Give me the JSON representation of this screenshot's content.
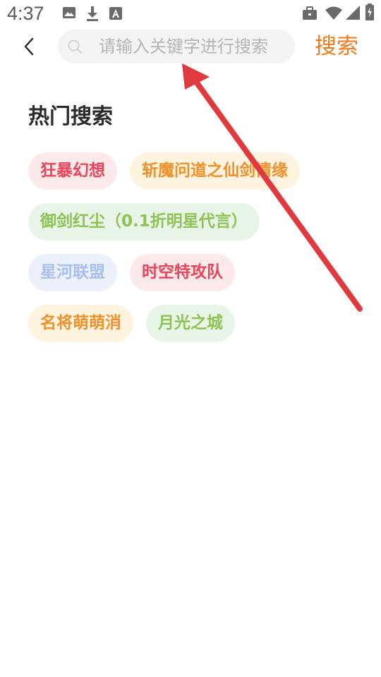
{
  "status_bar": {
    "time": "4:37",
    "icons": [
      "image-icon",
      "download-icon",
      "font-icon",
      "briefcase-icon",
      "wifi-icon",
      "signal-icon",
      "battery-icon"
    ]
  },
  "header": {
    "back_icon": "chevron-left-icon",
    "search": {
      "placeholder": "请输入关键字进行搜索",
      "value": ""
    },
    "search_button_label": "搜索"
  },
  "hot_search": {
    "title": "热门搜索",
    "rows": [
      [
        {
          "label": "狂暴幻想",
          "color": "red"
        },
        {
          "label": "斩魔问道之仙剑情缘",
          "color": "orange"
        }
      ],
      [
        {
          "label": "御剑红尘（0.1折明星代言）",
          "color": "green"
        }
      ],
      [
        {
          "label": "星河联盟",
          "color": "blue"
        },
        {
          "label": "时空特攻队",
          "color": "red"
        }
      ],
      [
        {
          "label": "名将萌萌消",
          "color": "orange"
        },
        {
          "label": "月光之城",
          "color": "green"
        }
      ]
    ]
  },
  "colors": {
    "accent": "#f27a1a",
    "tag_red": "#e8445a",
    "tag_orange": "#f0902a",
    "tag_green": "#8cc352",
    "tag_blue": "#a8c0ee",
    "annotation_arrow": "#e0393e"
  }
}
